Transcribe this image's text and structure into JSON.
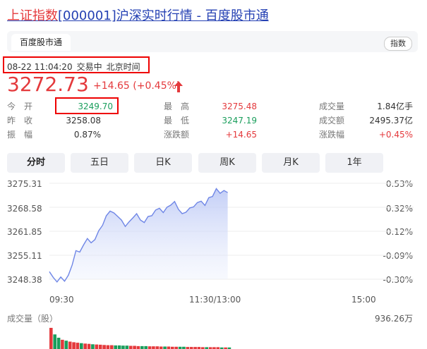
{
  "header": {
    "title_highlight": "上证指数",
    "title_rest": "[000001]沪深实时行情 - 百度股市通"
  },
  "tabbar": {
    "active_tab": "百度股市通",
    "tag": "指数"
  },
  "status": {
    "datetime": "08-22 11:04:20",
    "state": "交易中",
    "timezone": "北京时间"
  },
  "quote": {
    "price": "3272.73",
    "change": "+14.65 (+0.45%)"
  },
  "stats": {
    "row1": [
      {
        "label": "今　开",
        "value": "3249.70"
      },
      {
        "label": "最　高",
        "value": "3275.48"
      },
      {
        "label": "成交量",
        "value": "1.84亿手"
      }
    ],
    "row2": [
      {
        "label": "昨　收",
        "value": "3258.08"
      },
      {
        "label": "最　低",
        "value": "3247.19"
      },
      {
        "label": "成交额",
        "value": "2495.37亿"
      }
    ],
    "row3": [
      {
        "label": "振　幅",
        "value": "0.87%"
      },
      {
        "label": "涨跌额",
        "value": "+14.65"
      },
      {
        "label": "涨跌幅",
        "value": "+0.45%"
      }
    ]
  },
  "periods": [
    "分时",
    "五日",
    "日K",
    "周K",
    "月K",
    "1年"
  ],
  "colors": {
    "up": "#e4393c",
    "down": "#1a9e5c",
    "link": "#2440b3",
    "line": "#6f86e6"
  },
  "chart_data": {
    "type": "line",
    "y_labels": [
      "3275.31",
      "3268.58",
      "3261.85",
      "3255.11",
      "3248.38"
    ],
    "pct_labels": [
      "0.53%",
      "0.32%",
      "0.12%",
      "-0.09%",
      "-0.30%"
    ],
    "x_labels": [
      "09:30",
      "11:30/13:00",
      "15:00"
    ],
    "ylim": [
      3248.38,
      3275.31
    ],
    "volume_label": "成交量（股）",
    "volume_max": "936.26万",
    "x": [
      "09:30",
      "09:32",
      "09:34",
      "09:36",
      "09:38",
      "09:40",
      "09:42",
      "09:44",
      "09:46",
      "09:48",
      "09:50",
      "09:52",
      "09:54",
      "09:56",
      "09:58",
      "10:00",
      "10:02",
      "10:04",
      "10:06",
      "10:08",
      "10:10",
      "10:12",
      "10:14",
      "10:16",
      "10:18",
      "10:20",
      "10:22",
      "10:24",
      "10:26",
      "10:28",
      "10:30",
      "10:32",
      "10:34",
      "10:36",
      "10:38",
      "10:40",
      "10:42",
      "10:44",
      "10:46",
      "10:48",
      "10:50",
      "10:52",
      "10:54",
      "10:56",
      "10:58",
      "11:00",
      "11:02",
      "11:04"
    ],
    "values": [
      3250.5,
      3248.9,
      3247.6,
      3249.0,
      3247.8,
      3249.5,
      3252.4,
      3256.4,
      3256.0,
      3258.0,
      3259.8,
      3258.6,
      3259.5,
      3262.0,
      3263.5,
      3266.2,
      3267.5,
      3267.0,
      3266.0,
      3265.0,
      3263.2,
      3264.5,
      3265.6,
      3266.8,
      3265.0,
      3264.3,
      3266.0,
      3266.2,
      3267.8,
      3268.3,
      3267.1,
      3268.6,
      3269.2,
      3270.2,
      3268.0,
      3266.8,
      3267.2,
      3268.4,
      3268.7,
      3269.9,
      3270.3,
      3269.1,
      3271.3,
      3271.6,
      3273.8,
      3272.5,
      3273.3,
      3272.7
    ],
    "volume": [
      9.4,
      6.5,
      5.0,
      4.1,
      3.7,
      3.3,
      3.0,
      2.8,
      2.6,
      2.4,
      2.3,
      2.1,
      2.0,
      1.9,
      1.8,
      1.7,
      1.7,
      1.6,
      1.6,
      1.5,
      1.5,
      1.4,
      1.4,
      1.3,
      1.3,
      1.3,
      1.2,
      1.2,
      1.2,
      1.1,
      1.1,
      1.1,
      1.0,
      1.0,
      1.0,
      1.0,
      0.9,
      0.9,
      0.9,
      0.9,
      0.8,
      0.8,
      0.8,
      0.8,
      0.8,
      0.7,
      0.7,
      0.7
    ]
  }
}
